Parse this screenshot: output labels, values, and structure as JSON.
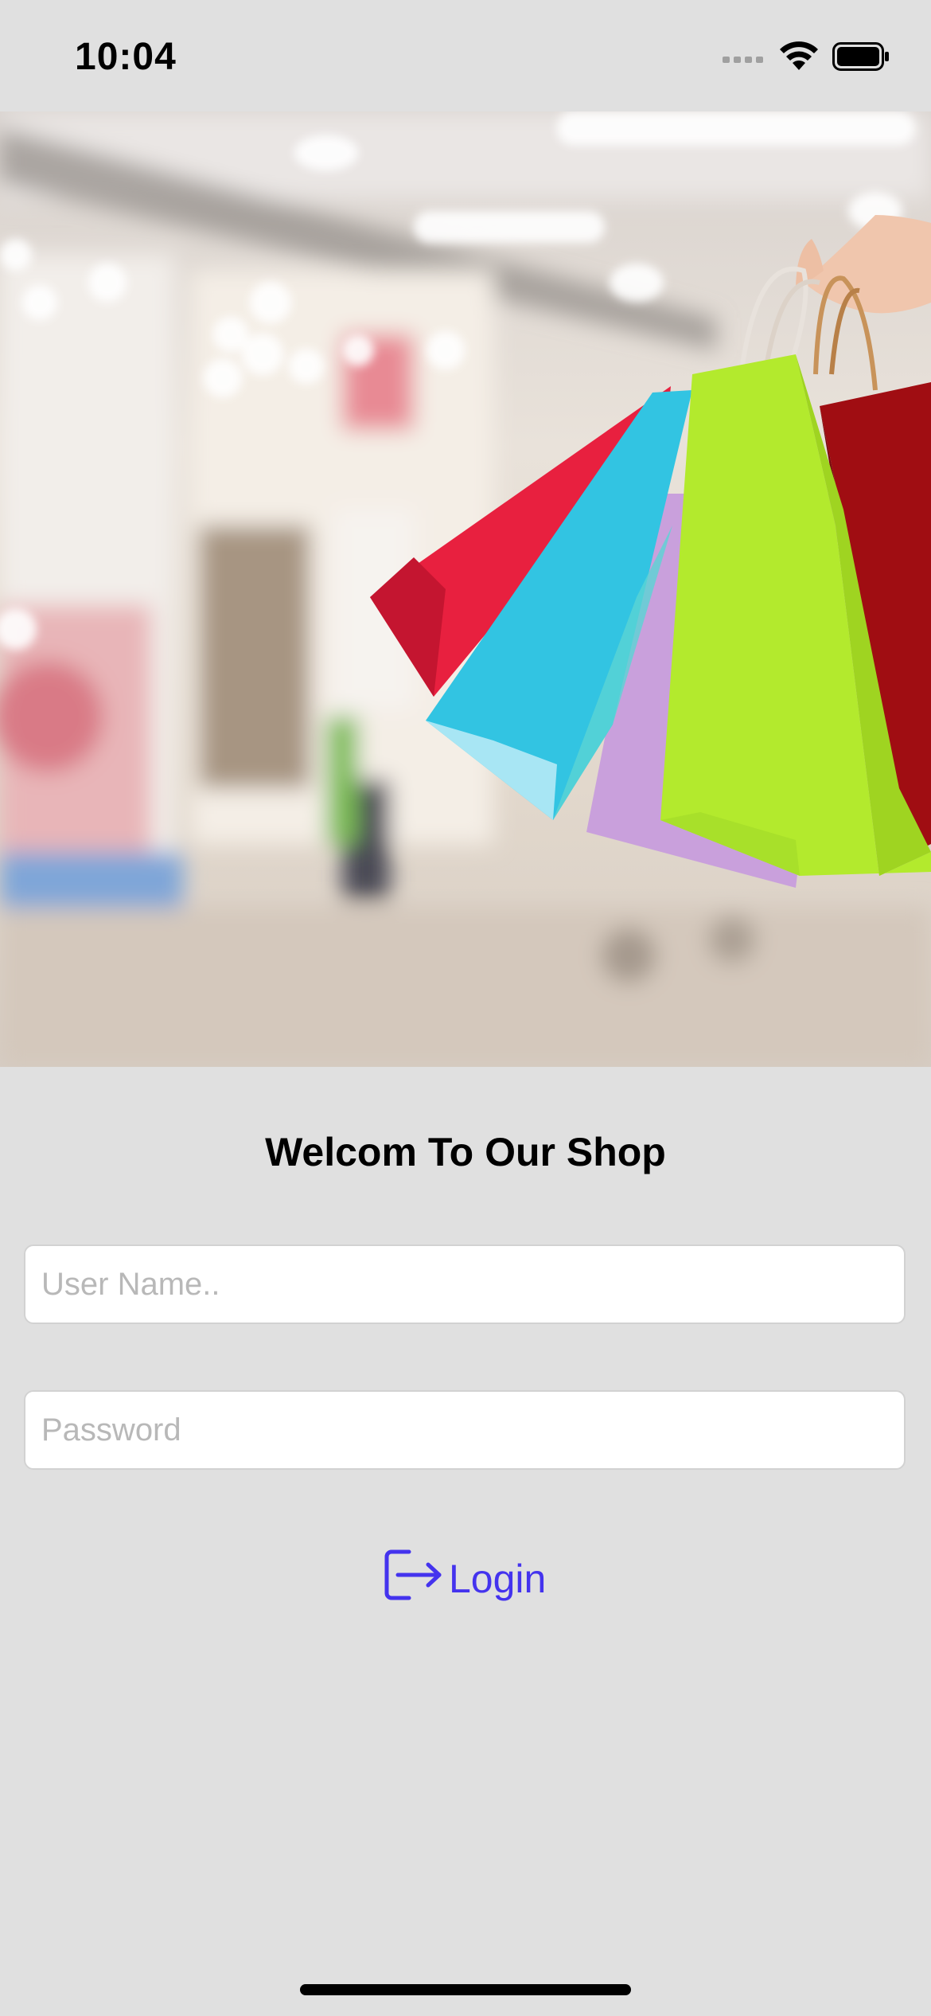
{
  "status_bar": {
    "time": "10:04",
    "icons": [
      "signal-icon",
      "wifi-icon",
      "battery-icon"
    ]
  },
  "hero": {
    "image": "hero-image",
    "bag_colors": [
      "#e8203f",
      "#32c4e2",
      "#c9a0dc",
      "#b3ea2d",
      "#a00d12"
    ]
  },
  "welcome": {
    "title": "Welcom To Our Shop"
  },
  "form": {
    "username_placeholder": "User Name..",
    "username_value": "",
    "password_placeholder": "Password",
    "password_value": ""
  },
  "login": {
    "label": "Login",
    "icon": "login-icon"
  },
  "colors": {
    "background": "#e0e0e0",
    "accent": "#4433ee",
    "placeholder": "#b8b8b8"
  }
}
